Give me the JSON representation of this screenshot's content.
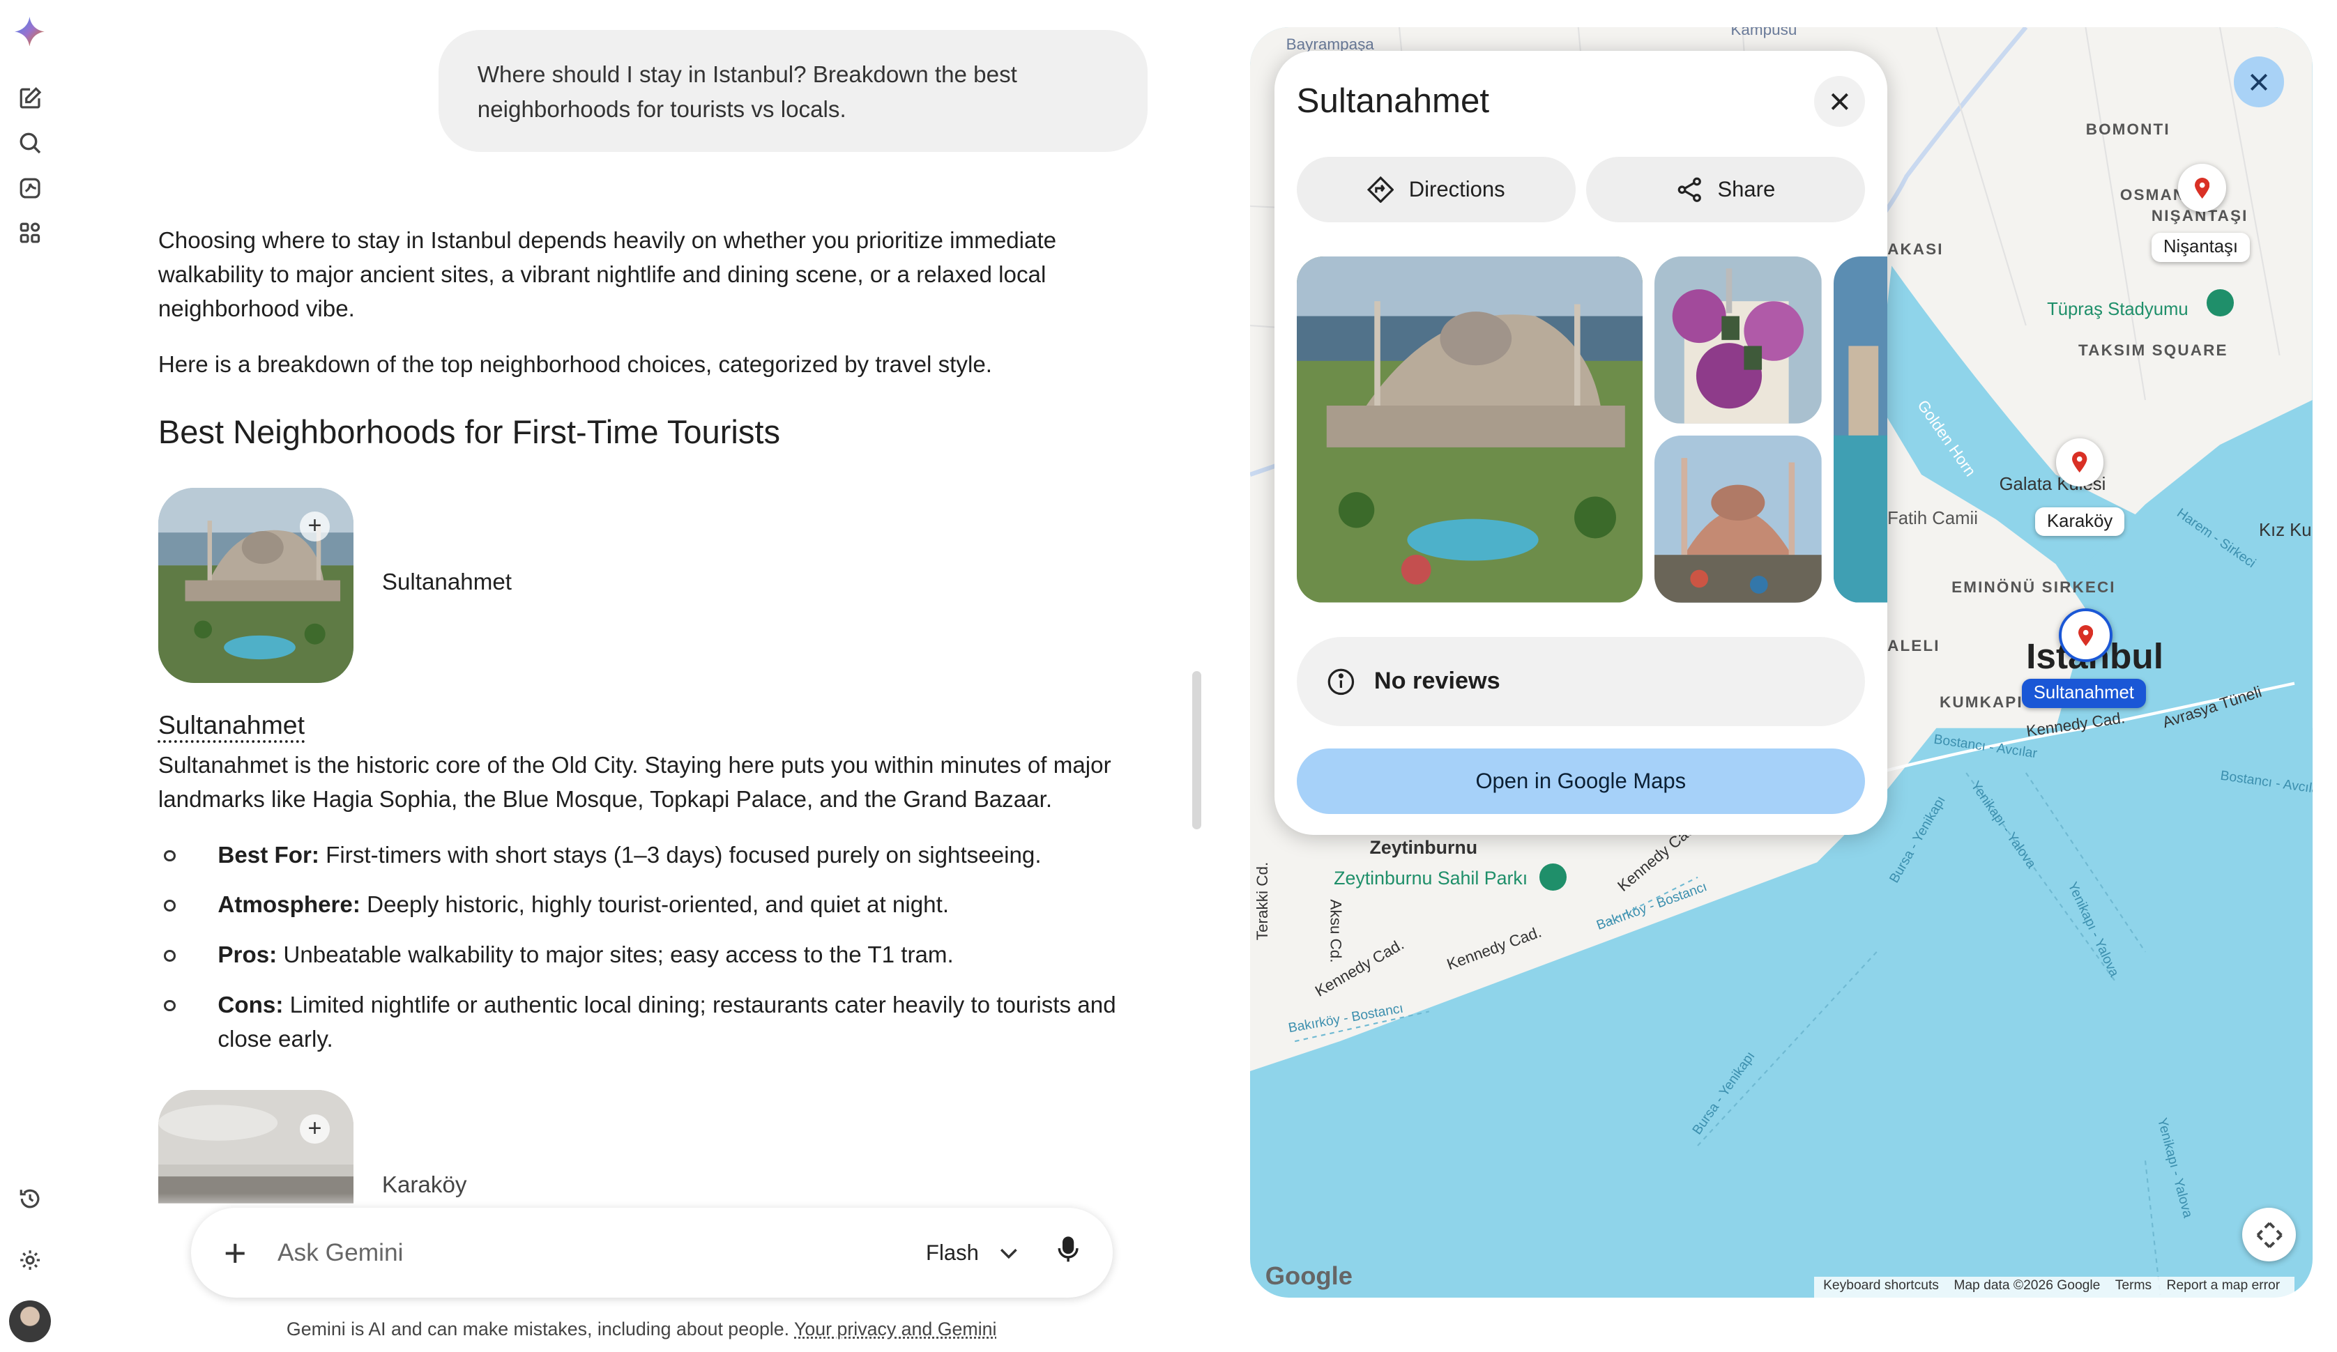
{
  "rail": {
    "icons": [
      "gemini-logo-icon",
      "new-chat-icon",
      "search-icon",
      "gems-icon",
      "apps-icon",
      "history-icon",
      "settings-icon",
      "avatar"
    ]
  },
  "user_prompt": "Where should I stay in Istanbul? Breakdown the best neighborhoods for tourists vs locals.",
  "response": {
    "intro_p1": "Choosing where to stay in Istanbul depends heavily on whether you prioritize immediate walkability to major ancient sites, a vibrant nightlife and dining scene, or a relaxed local neighborhood vibe.",
    "intro_p2": "Here is a breakdown of the top neighborhood choices, categorized by travel style.",
    "heading": "Best Neighborhoods for First-Time Tourists",
    "card1_label": "Sultanahmet",
    "section_title": "Sultanahmet",
    "section_desc": "Sultanahmet is the historic core of the Old City. Staying here puts you within minutes of major landmarks like Hagia Sophia, the Blue Mosque, Topkapi Palace, and the Grand Bazaar.",
    "bullets": [
      {
        "label": "Best For:",
        "text": " First-timers with short stays (1–3 days) focused purely on sightseeing."
      },
      {
        "label": "Atmosphere:",
        "text": " Deeply historic, highly tourist-oriented, and quiet at night."
      },
      {
        "label": "Pros:",
        "text": " Unbeatable walkability to major sites; easy access to the T1 tram."
      },
      {
        "label": "Cons:",
        "text": " Limited nightlife or authentic local dining; restaurants cater heavily to tourists and close early."
      }
    ],
    "card2_label": "Karaköy"
  },
  "input": {
    "placeholder": "Ask Gemini",
    "model": "Flash"
  },
  "disclaimer": {
    "text": "Gemini is AI and can make mistakes, including about people. ",
    "link": "Your privacy and Gemini"
  },
  "place_card": {
    "title": "Sultanahmet",
    "directions": "Directions",
    "share": "Share",
    "reviews": "No reviews",
    "open_maps": "Open in Google Maps"
  },
  "map": {
    "labels": {
      "bayrampasa": "Bayrampaşa",
      "kampusu": "Kampusu",
      "bomonti": "BOMONTI",
      "osman": "OSMAN",
      "nisantasi_cap": "NIŞANTAŞI",
      "nisantasi": "Nişantaşı",
      "tupras": "Tüpraş Stadyumu",
      "taksim": "TAKSIM SQUARE",
      "kasi": "AKASI",
      "golden_horn": "Golden Horn",
      "galata": "Galata Kulesi",
      "karakoy": "Karaköy",
      "fatih": "Fatih Camii",
      "eminonu": "EMINÖNÜ SIRKECI",
      "aleli": "ALELI",
      "istanbul": "Istanbul",
      "sultanahmet": "Sultanahmet",
      "kumkapi": "KUMKAPI",
      "kennedy": "Kennedy Cad.",
      "avrasya": "Avrasya Tüneli",
      "kiz": "Kız Ku",
      "harem": "Harem - Sirkeci",
      "zeytinburnu": "Zeytinburnu",
      "zeytin_park": "Zeytinburnu Sahil Parkı",
      "bostanci": "Bostancı - Avcılar",
      "bakirkoy": "Bakırköy - Bostancı",
      "yenikapi": "Yenikapı - Yalova",
      "bursa": "Bursa - Yenikapı",
      "terakki": "Terakki Cd.",
      "aksu": "Aksu Cd.",
      "google": "Google"
    },
    "attribution": [
      "Keyboard shortcuts",
      "Map data ©2026 Google",
      "Terms",
      "Report a map error"
    ]
  }
}
